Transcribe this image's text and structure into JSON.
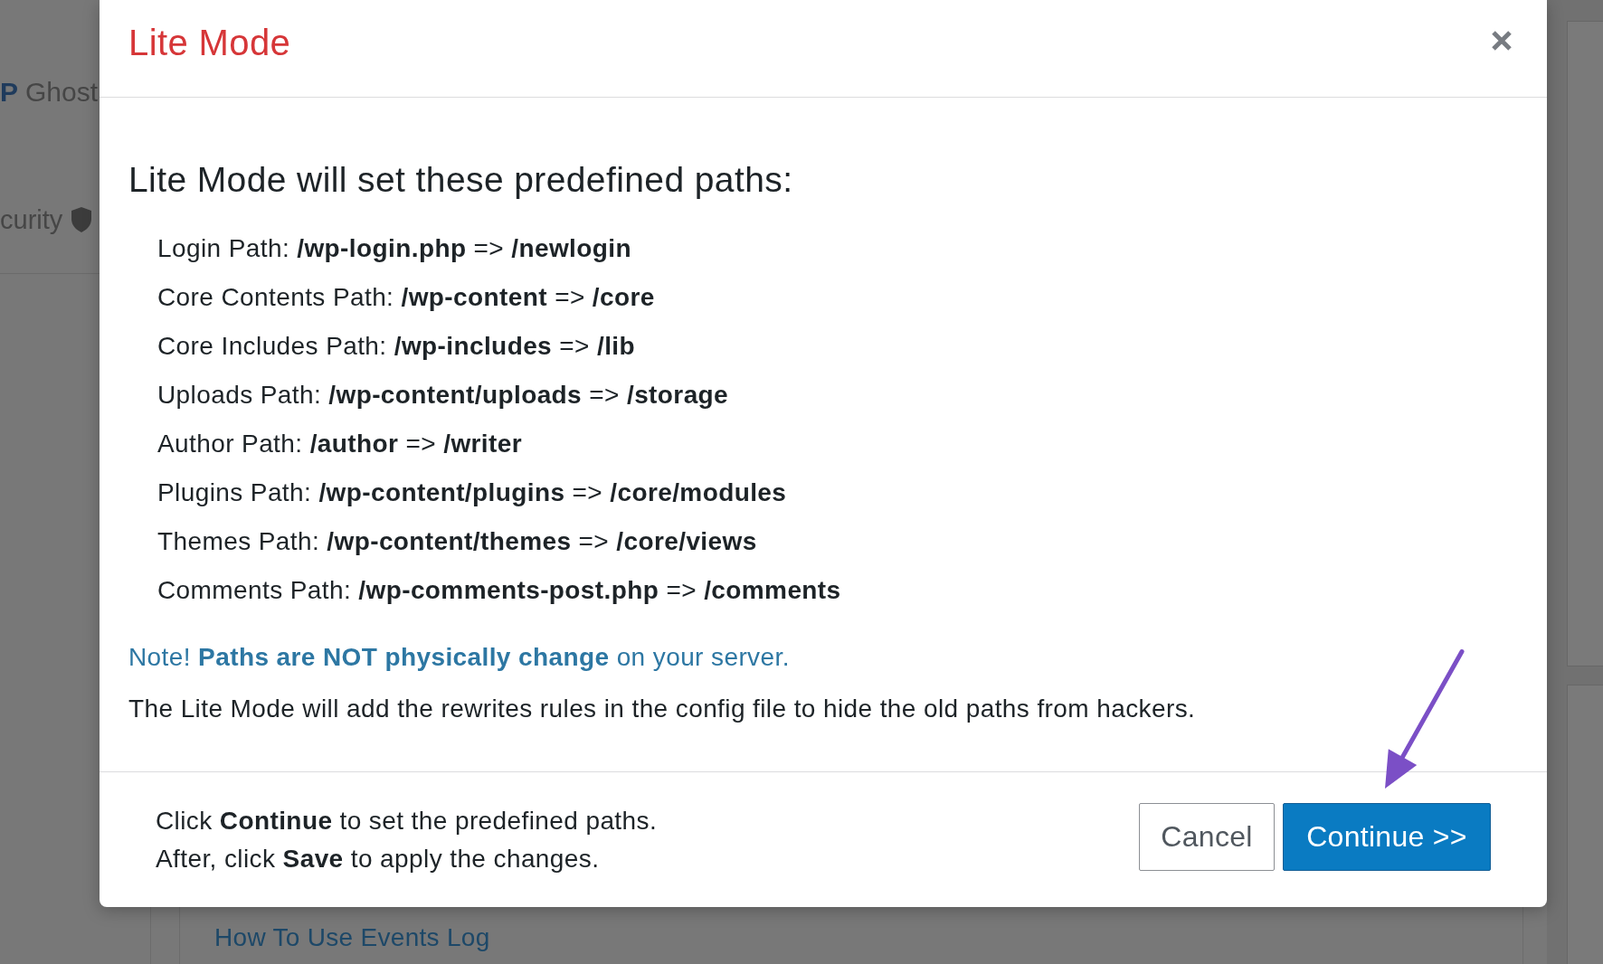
{
  "background": {
    "brand_mark": "P",
    "brand_name": "Ghost",
    "menu_item": "curity",
    "link": "How To Use Events Log"
  },
  "dialog": {
    "title": "Lite Mode",
    "heading": "Lite Mode will set these predefined paths:",
    "paths": [
      "Login Path: **/wp-login.php** => **/newlogin**",
      "Core Contents Path: **/wp-content** => **/core**",
      "Core Includes Path: **/wp-includes** => **/lib**",
      "Uploads Path: **/wp-content/uploads** => **/storage**",
      "Author Path: **/author** => **/writer**",
      "Plugins Path: **/wp-content/plugins** => **/core/modules**",
      "Themes Path: **/wp-content/themes** => **/core/views**",
      "Comments Path: **/wp-comments-post.php** => **/comments**"
    ],
    "note": "Note! **Paths are NOT physically change** on your server.",
    "description": "The Lite Mode will add the rewrites rules in the config file to hide the old paths from hackers.",
    "footer_lines": [
      "Click **Continue** to set the predefined paths.",
      "After, click **Save** to apply the changes."
    ],
    "buttons": [
      {
        "label": "Cancel",
        "kind": "secondary"
      },
      {
        "label": "Continue >>",
        "kind": "primary"
      }
    ]
  }
}
